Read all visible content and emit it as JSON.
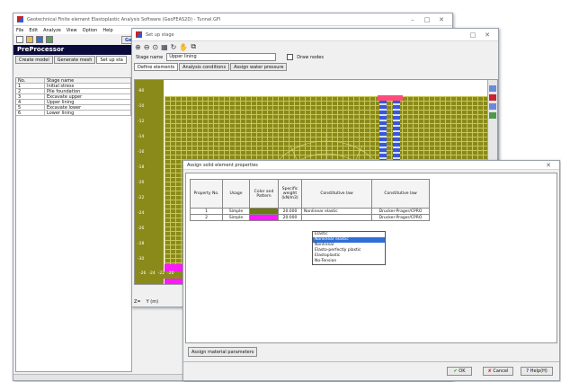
{
  "main_window": {
    "title": "Geotechnical Finite element Elastoplastic Analysis Software (GeoFEAS2D) - Tunnel.GFI",
    "menu": [
      "File",
      "Edit",
      "Analyze",
      "View",
      "Option",
      "Help"
    ],
    "geometry_button": "Geometry",
    "panel_title": "PreProcessor",
    "tabs": [
      "Create model",
      "Generate mesh",
      "Set up sta"
    ],
    "table_headers": {
      "no": "No.",
      "name": "Stage name"
    },
    "stages": [
      {
        "no": "1",
        "name": "Initial stress"
      },
      {
        "no": "2",
        "name": "Pile foundation"
      },
      {
        "no": "3",
        "name": "Excavate upper"
      },
      {
        "no": "4",
        "name": "Upper lining"
      },
      {
        "no": "5",
        "name": "Excavate lower"
      },
      {
        "no": "6",
        "name": "Lower lining"
      }
    ]
  },
  "setup_window": {
    "title": "Set up stage",
    "stage_name_label": "Stage name",
    "stage_name_value": "Upper lining",
    "draw_nodes_label": "Draw nodes",
    "tabs": [
      "Define elements",
      "Analysis conditions",
      "Assign water pressure"
    ],
    "y_labels": [
      "-80",
      "-10",
      "-12",
      "-14",
      "-16",
      "-18",
      "-20",
      "-22",
      "-24",
      "-26",
      "-28",
      "-30"
    ],
    "x_labels": [
      "-26",
      "-24",
      "-22",
      "-20"
    ],
    "footer_labels": [
      "Z=",
      "Y (m)"
    ]
  },
  "dialog": {
    "title": "Assign solid element properties",
    "headers": [
      "Property No.",
      "Usage",
      "Color and Pattern",
      "Specific weight (kN/m3)",
      "Constitutive law",
      "Constitutive law"
    ],
    "rows": [
      {
        "no": "1",
        "usage": "Simple",
        "color": "#6f7a12",
        "weight": "20.000",
        "law": "Nonlinear elastic",
        "law2": "Drucker-Prager/CPRO"
      },
      {
        "no": "2",
        "usage": "Simple",
        "color": "#ff18ff",
        "weight": "20.000",
        "law": "",
        "law2": "Drucker-Prager/CPRO"
      }
    ],
    "dropdown_options": [
      "Elastic",
      "Nonlinear elastic",
      "Nonlinear",
      "Elasto-perfectly plastic",
      "Elastoplastic",
      "No-Tension"
    ],
    "dropdown_selected": 1,
    "assign_button": "Assign material parameters",
    "ok": "OK",
    "cancel": "Cancel",
    "help": "Help(H)"
  },
  "colors": {
    "soil": "#8a8a1a",
    "magenta": "#ff18ff",
    "grid": "#c8c85a",
    "pile": "#3b57d9",
    "select": "#2f6fd6"
  }
}
